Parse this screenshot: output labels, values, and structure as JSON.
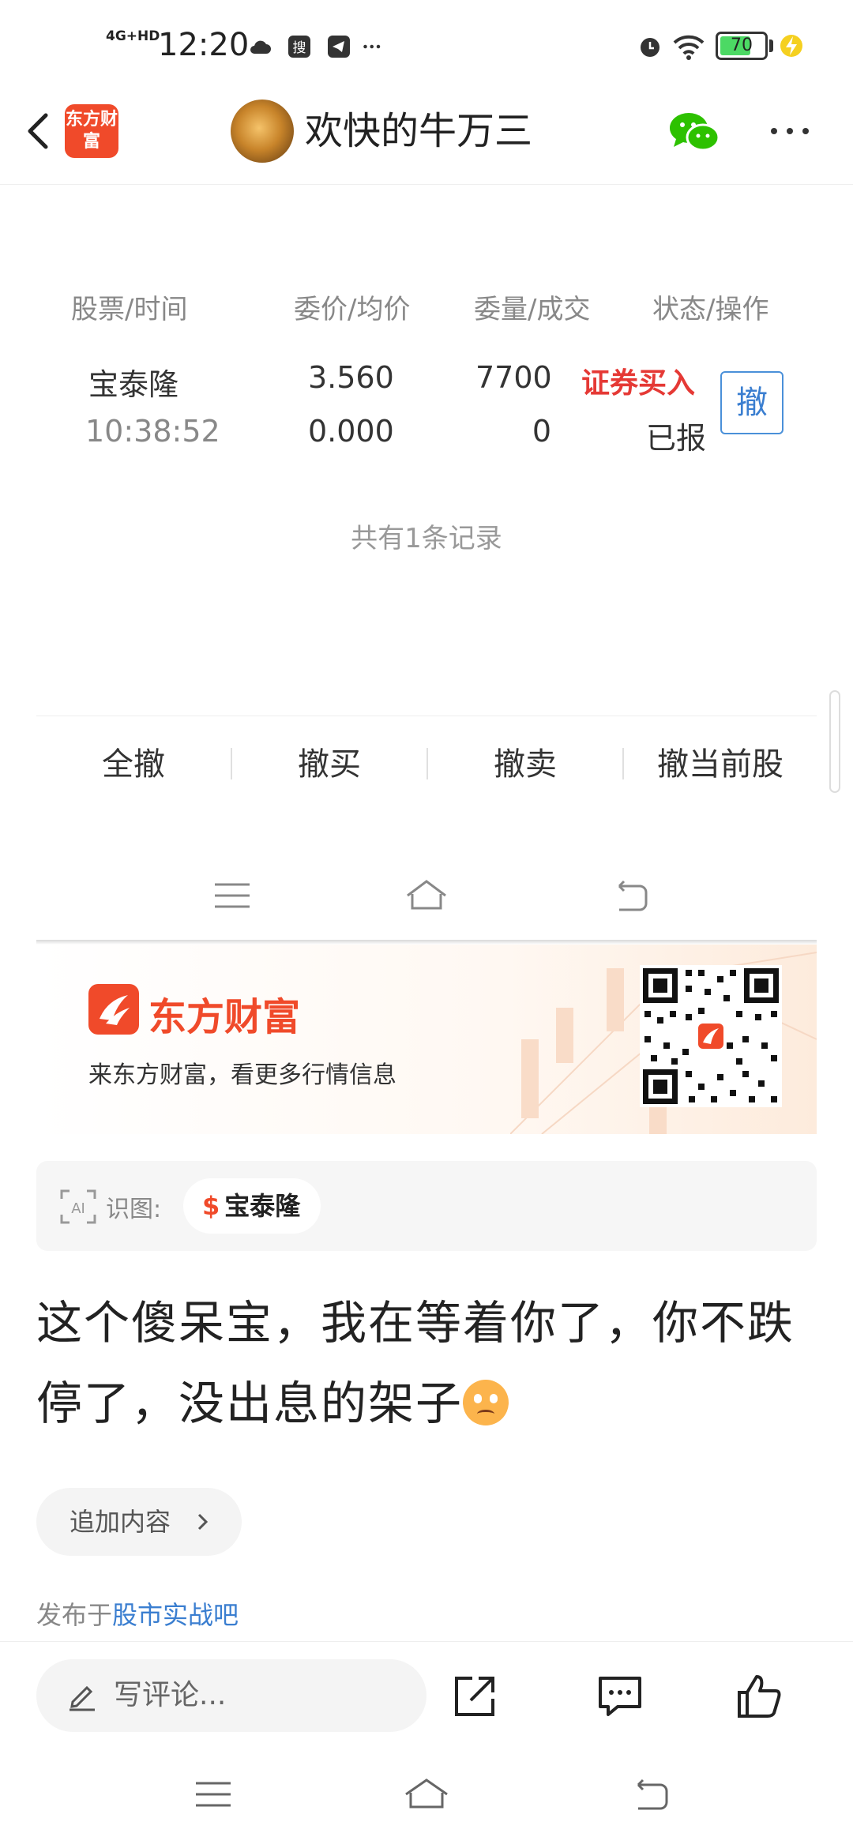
{
  "status_bar": {
    "network": "4G+HD",
    "time": "12:20",
    "battery": "70",
    "battery_fraction": 0.7
  },
  "header": {
    "app_logo_text": "东方财富",
    "title": "欢快的牛万三"
  },
  "orders": {
    "columns": [
      "股票/时间",
      "委价/均价",
      "委量/成交",
      "状态/操作"
    ],
    "rows": [
      {
        "stock": "宝泰隆",
        "time": "10:38:52",
        "price": "3.560",
        "avg_price": "0.000",
        "quantity": "7700",
        "filled": "0",
        "type": "证券买入",
        "status": "已报",
        "cancel_label": "撤"
      }
    ],
    "record_count": "共有1条记录",
    "actions": [
      "全撤",
      "撤买",
      "撤卖",
      "撤当前股"
    ]
  },
  "banner": {
    "brand": "东方财富",
    "slogan": "来东方财富，看更多行情信息"
  },
  "tag": {
    "label": "识图:",
    "symbol": "$",
    "stock": "宝泰隆"
  },
  "post": {
    "text": "这个傻呆宝，我在等着你了，你不跌停了，没出息的架子",
    "add_content": "追加内容",
    "published_prefix": "发布于",
    "published_forum": "股市实战吧"
  },
  "bottom_bar": {
    "comment_placeholder": "写评论..."
  },
  "colors": {
    "brand_orange": "#f04a2a",
    "buy_red": "#e53935",
    "link_blue": "#3a7ed0",
    "wechat_green": "#2dc100",
    "battery_green": "#4cd964"
  },
  "icons": [
    "back-icon",
    "wechat-icon",
    "more-icon",
    "menu-icon",
    "home-icon",
    "return-icon",
    "ai-scan-icon",
    "pencil-icon",
    "share-icon",
    "comment-icon",
    "like-icon",
    "alarm-icon",
    "wifi-icon",
    "charging-icon",
    "cloud-icon",
    "search-app-icon",
    "telegram-icon"
  ]
}
